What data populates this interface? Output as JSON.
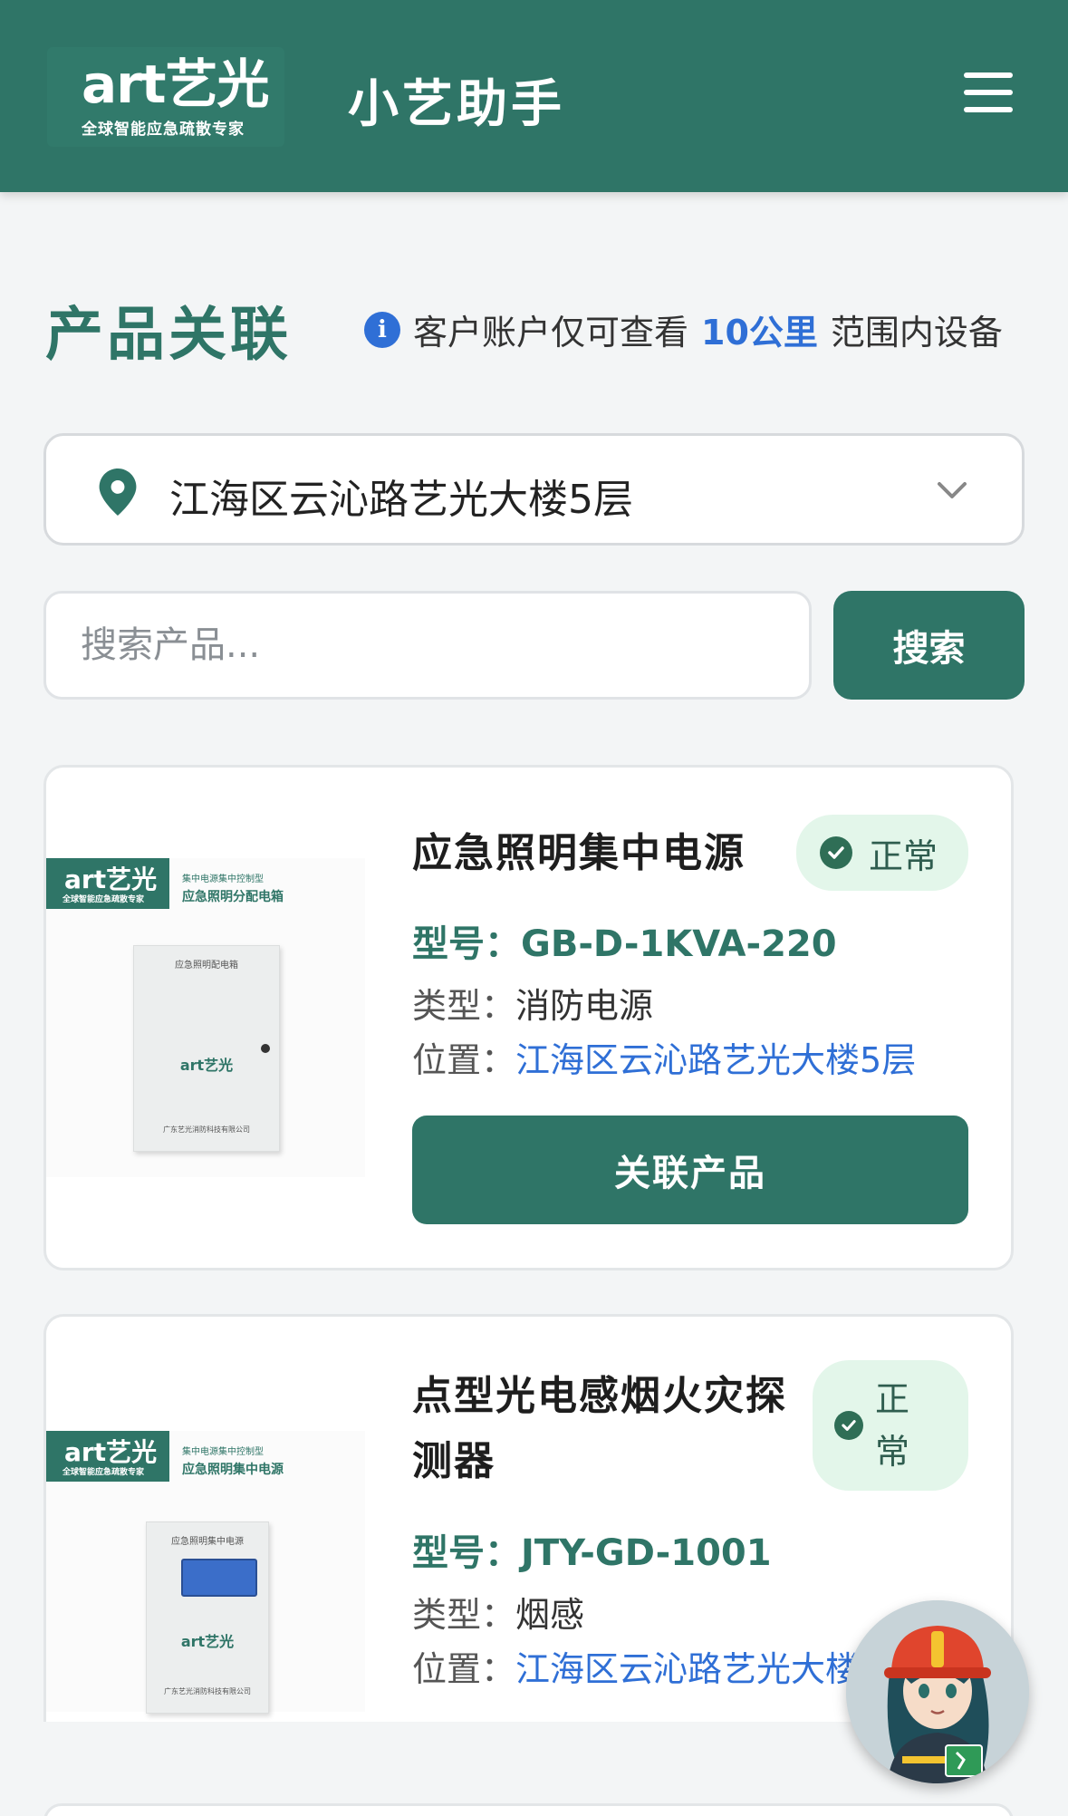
{
  "header": {
    "logo_main": "art艺光",
    "logo_sub": "全球智能应急疏散专家",
    "app_title": "小艺助手",
    "menu_icon": "hamburger-menu-icon"
  },
  "section": {
    "title": "产品关联",
    "notice_prefix": "客户账户仅可查看",
    "notice_highlight": "10公里",
    "notice_suffix": "范围内设备"
  },
  "location": {
    "selected": "江海区云沁路艺光大楼5层"
  },
  "search": {
    "placeholder": "搜索产品...",
    "button_label": "搜索"
  },
  "products": [
    {
      "name": "应急照明集中电源",
      "status": "正常",
      "model_label": "型号：",
      "model": "GB-D-1KVA-220",
      "type_label": "类型：",
      "type": "消防电源",
      "location_label": "位置：",
      "location": "江海区云沁路艺光大楼5层",
      "button_label": "关联产品",
      "thumb": {
        "logo": "art艺光",
        "logo_sub": "全球智能应急疏散专家",
        "caption_small": "集中电源集中控制型",
        "caption_main": "应急照明分配电箱",
        "box_title": "应急照明配电箱",
        "box_logo": "art艺光",
        "box_footer": "广东艺光消防科技有限公司"
      }
    },
    {
      "name": "点型光电感烟火灾探测器",
      "status_line1": "正",
      "status_line2": "常",
      "model_label": "型号：",
      "model": "JTY-GD-1001",
      "type_label": "类型：",
      "type": "烟感",
      "location_label": "位置：",
      "location": "江海区云沁路艺光大楼",
      "thumb": {
        "logo": "art艺光",
        "logo_sub": "全球智能应急疏散专家",
        "caption_small": "集中电源集中控制型",
        "caption_main": "应急照明集中电源",
        "box_title": "应急照明集中电源",
        "box_logo": "art艺光",
        "box_footer": "广东艺光消防科技有限公司"
      }
    }
  ],
  "colors": {
    "primary": "#2f7567",
    "accent_blue": "#2f6fd6",
    "badge_bg": "#e3f6ea",
    "page_bg": "#f3f5f6"
  }
}
